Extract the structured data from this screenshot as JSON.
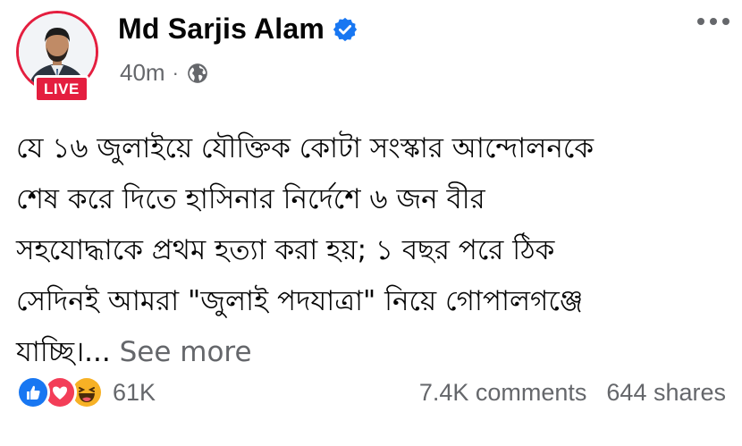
{
  "header": {
    "author_name": "Md Sarjis Alam",
    "live_label": "LIVE",
    "timestamp": "40m",
    "separator": "·",
    "audience_icon": "globe-icon",
    "verified_icon": "verified-badge-icon",
    "more_icon": "more-options-icon"
  },
  "post": {
    "lines": [
      "যে ১৬ জুলাইয়ে যৌক্তিক কোটা সংস্কার আন্দোলনকে",
      "শেষ করে দিতে হাসিনার নির্দেশে ৬ জন বীর",
      "সহযোদ্ধাকে প্রথম হত্যা করা হয়; ১ বছর পরে ঠিক",
      "সেদিনই আমরা \"জুলাই পদযাত্রা\" নিয়ে গোপালগঞ্জে",
      "যাচ্ছি।..."
    ],
    "see_more": "See more"
  },
  "footer": {
    "reaction_icons": [
      "like-icon",
      "love-icon",
      "haha-icon"
    ],
    "reaction_count": "61K",
    "comments": "7.4K comments",
    "shares": "644 shares"
  },
  "colors": {
    "live_red": "#e41e3f",
    "verified_blue": "#1877f2",
    "secondary_text": "#65676b",
    "like_blue": "#1877f2",
    "love_red": "#f33e58",
    "haha_yellow": "#f7b125"
  }
}
